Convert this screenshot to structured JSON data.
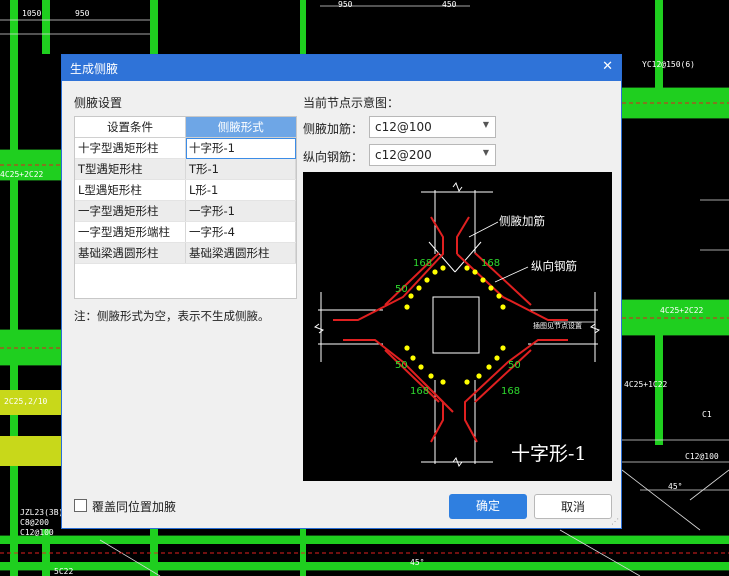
{
  "dialog": {
    "title": "生成侧腋",
    "close_glyph": "✕",
    "settings_label": "侧腋设置",
    "table": {
      "headers": [
        "设置条件",
        "侧腋形式"
      ],
      "rows": [
        [
          "十字型遇矩形柱",
          "十字形-1"
        ],
        [
          "T型遇矩形柱",
          "T形-1"
        ],
        [
          "L型遇矩形柱",
          "L形-1"
        ],
        [
          "一字型遇矩形柱",
          "一字形-1"
        ],
        [
          "一字型遇矩形端柱",
          "一字形-4"
        ],
        [
          "基础梁遇圆形柱",
          "基础梁遇圆形柱"
        ]
      ]
    },
    "note": "注：侧腋形式为空，表示不生成侧腋。",
    "preview_label": "当前节点示意图：",
    "haunch_rebar": {
      "label": "侧腋加筋：",
      "value": "c12@100"
    },
    "long_rebar": {
      "label": "纵向钢筋：",
      "value": "c12@200"
    },
    "overwrite_label": "覆盖同位置加腋",
    "ok_label": "确定",
    "cancel_label": "取消"
  },
  "diagram": {
    "label_haunch": "侧腋加筋",
    "label_long": "纵向钢筋",
    "dim_168": "168",
    "dim_50": "50",
    "detail_note": "插图见节点设置",
    "shape_name": "十字形-1"
  },
  "background": {
    "labels": [
      "1050",
      "950",
      "950",
      "450",
      "4C25+2C22",
      "YC12@150(6)",
      "4C25+2C22",
      "C12@100",
      "C1",
      "5C22",
      "4C25+1C22",
      "2C25,2/10",
      "JZL23(3B)50",
      "C8@200",
      "C12@100",
      "45°",
      "45°"
    ]
  },
  "colors": {
    "accent": "#2f73d8",
    "cad_green": "#2bd62b",
    "cad_red": "#e02020",
    "cad_yellow": "#ffff00"
  }
}
